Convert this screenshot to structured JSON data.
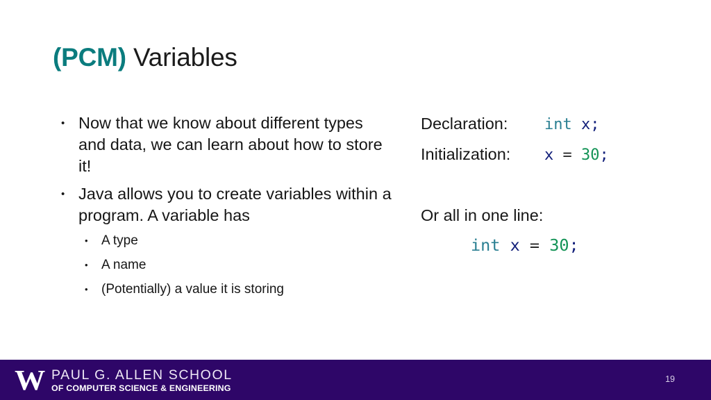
{
  "slide": {
    "background_color": "#ffffff",
    "title": {
      "accent_text": "(PCM)",
      "accent_color": "#0b7c7e",
      "plain_text": " Variables",
      "plain_color": "#1b1b1b"
    }
  },
  "left_column": {
    "bullets": [
      {
        "text": "Now that we know about different types and data, we can learn about how to store it!",
        "sub_bullets": []
      },
      {
        "text": "Java allows you to create variables within a program. A variable has",
        "sub_bullets": [
          "A type",
          "A name",
          "(Potentially) a value it is storing"
        ]
      }
    ]
  },
  "right_column": {
    "rows": [
      {
        "label": "Declaration:",
        "code_tokens": [
          {
            "text": "int",
            "type": "keyword"
          },
          {
            "text": " ",
            "type": "space"
          },
          {
            "text": "x",
            "type": "variable"
          },
          {
            "text": ";",
            "type": "punctuation"
          }
        ]
      },
      {
        "label": "Initialization:",
        "code_tokens": [
          {
            "text": "x",
            "type": "variable"
          },
          {
            "text": " = ",
            "type": "operator"
          },
          {
            "text": "30",
            "type": "number"
          },
          {
            "text": ";",
            "type": "punctuation"
          }
        ]
      }
    ],
    "oneline_label": "Or all in one line:",
    "oneline_tokens": [
      {
        "text": "int",
        "type": "keyword"
      },
      {
        "text": " ",
        "type": "space"
      },
      {
        "text": "x",
        "type": "variable"
      },
      {
        "text": " = ",
        "type": "operator"
      },
      {
        "text": "30",
        "type": "number"
      },
      {
        "text": ";",
        "type": "punctuation"
      }
    ],
    "token_colors": {
      "keyword": "#2a7f92",
      "variable": "#121f7a",
      "number": "#139356",
      "punctuation": "#121f7a",
      "operator": "#2a2a2a"
    }
  },
  "footer": {
    "background_color": "#2e0668",
    "logo_mark": "W",
    "school_line1": "PAUL G. ALLEN SCHOOL",
    "school_line2": "OF COMPUTER SCIENCE & ENGINEERING",
    "page_number": "19"
  }
}
